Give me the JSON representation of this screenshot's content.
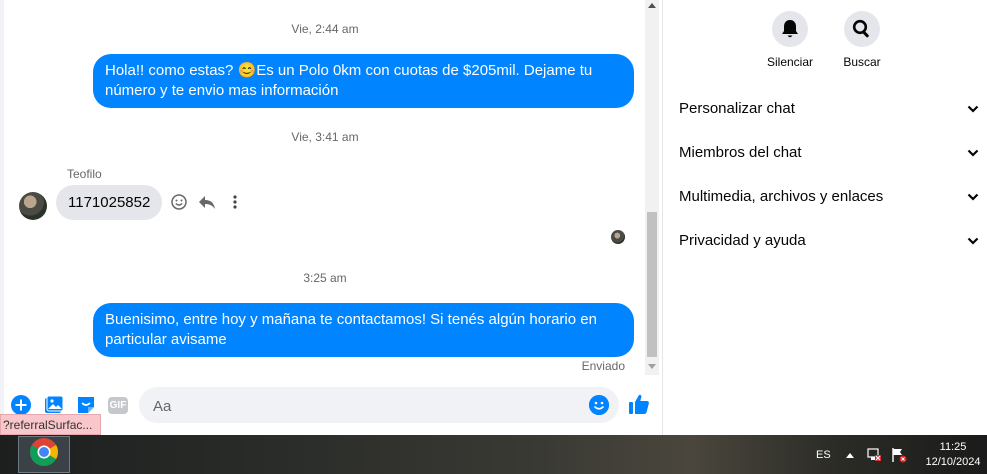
{
  "conversation": {
    "timestamp_1": "Vie, 2:44 am",
    "outgoing_1": "Hola!! como estas? 😊Es un Polo 0km con cuotas de $205mil. Dejame tu número y te envio mas información",
    "timestamp_2": "Vie, 3:41 am",
    "sender_name": "Teofilo",
    "incoming_1": "1171025852",
    "timestamp_3": "3:25 am",
    "outgoing_2": "Buenisimo, entre hoy y mañana te contactamos! Si tenés algún horario en particular avisame",
    "status": "Enviado"
  },
  "composer": {
    "placeholder": "Aa",
    "icons": [
      "plus-icon",
      "photo-icon",
      "sticker-icon",
      "gif-icon",
      "emoji-icon",
      "thumbs-up-icon"
    ],
    "gif_label": "GIF"
  },
  "status_url": "?referralSurfac...",
  "sidebar": {
    "actions": [
      {
        "label": "Silenciar",
        "icon": "bell-icon"
      },
      {
        "label": "Buscar",
        "icon": "search-icon"
      }
    ],
    "sections": [
      {
        "label": "Personalizar chat"
      },
      {
        "label": "Miembros del chat"
      },
      {
        "label": "Multimedia, archivos y enlaces"
      },
      {
        "label": "Privacidad y ayuda"
      }
    ]
  },
  "taskbar": {
    "language": "ES",
    "time": "11:25",
    "date": "12/10/2024"
  },
  "colors": {
    "accent": "#0084ff",
    "incoming_bubble": "#e4e6eb",
    "muted_text": "#65676b"
  }
}
